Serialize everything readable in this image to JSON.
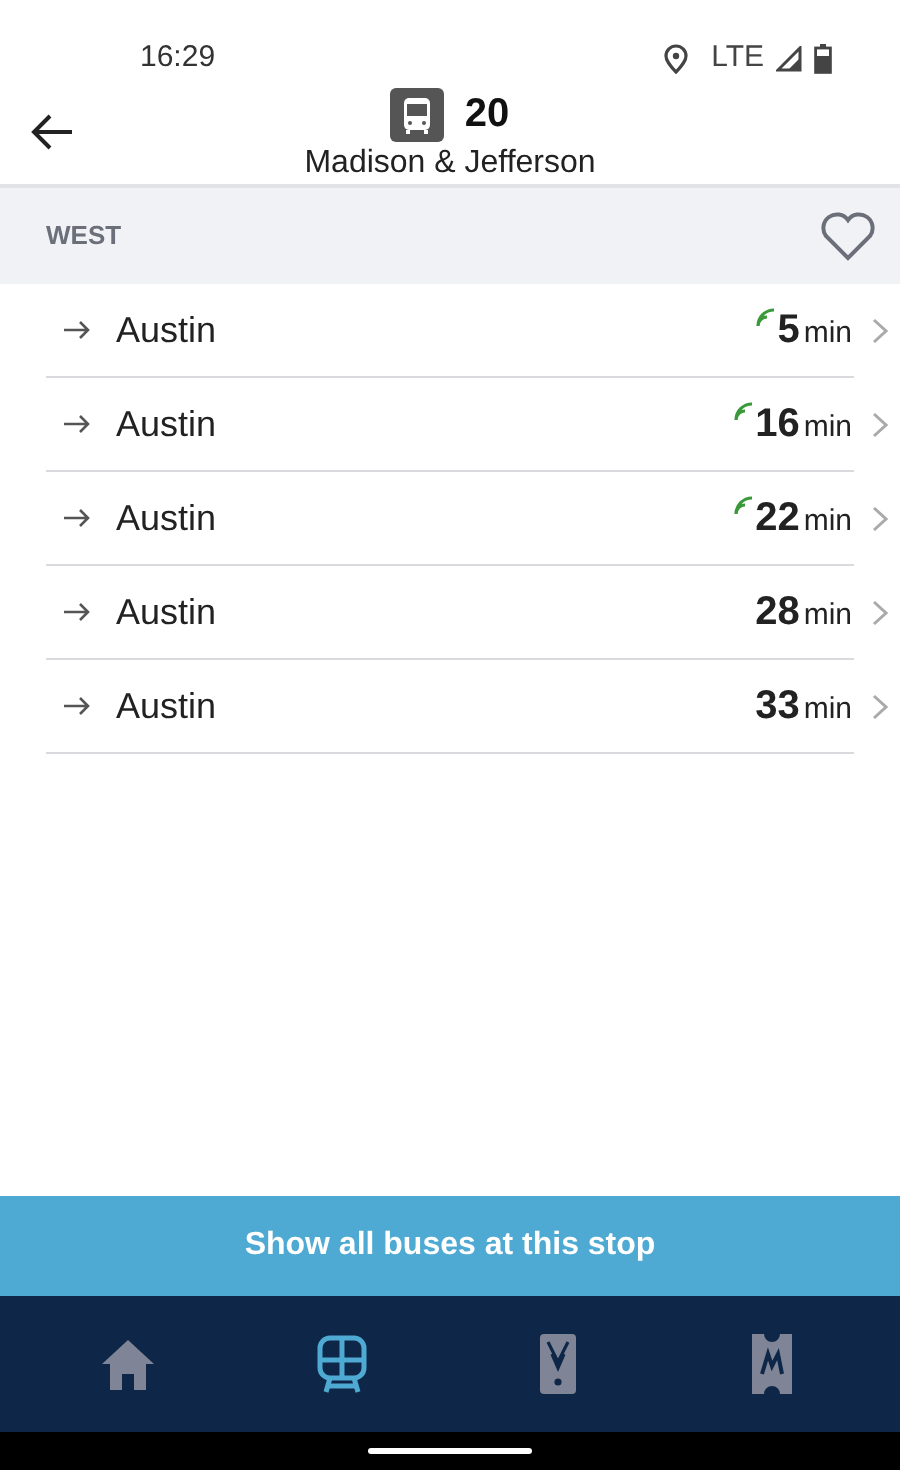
{
  "status_bar": {
    "time": "16:29",
    "network": "LTE"
  },
  "header": {
    "route": "20",
    "stop": "Madison & Jefferson"
  },
  "direction": {
    "label": "WEST",
    "favorite": false
  },
  "arrivals": [
    {
      "destination": "Austin",
      "minutes": "5",
      "unit": "min",
      "realtime": true
    },
    {
      "destination": "Austin",
      "minutes": "16",
      "unit": "min",
      "realtime": true
    },
    {
      "destination": "Austin",
      "minutes": "22",
      "unit": "min",
      "realtime": true
    },
    {
      "destination": "Austin",
      "minutes": "28",
      "unit": "min",
      "realtime": false
    },
    {
      "destination": "Austin",
      "minutes": "33",
      "unit": "min",
      "realtime": false
    }
  ],
  "action_button": "Show all buses at this stop",
  "nav": [
    {
      "kind": "home",
      "selected": false
    },
    {
      "kind": "train",
      "selected": true
    },
    {
      "kind": "pass",
      "selected": false
    },
    {
      "kind": "ticket",
      "selected": false
    }
  ]
}
